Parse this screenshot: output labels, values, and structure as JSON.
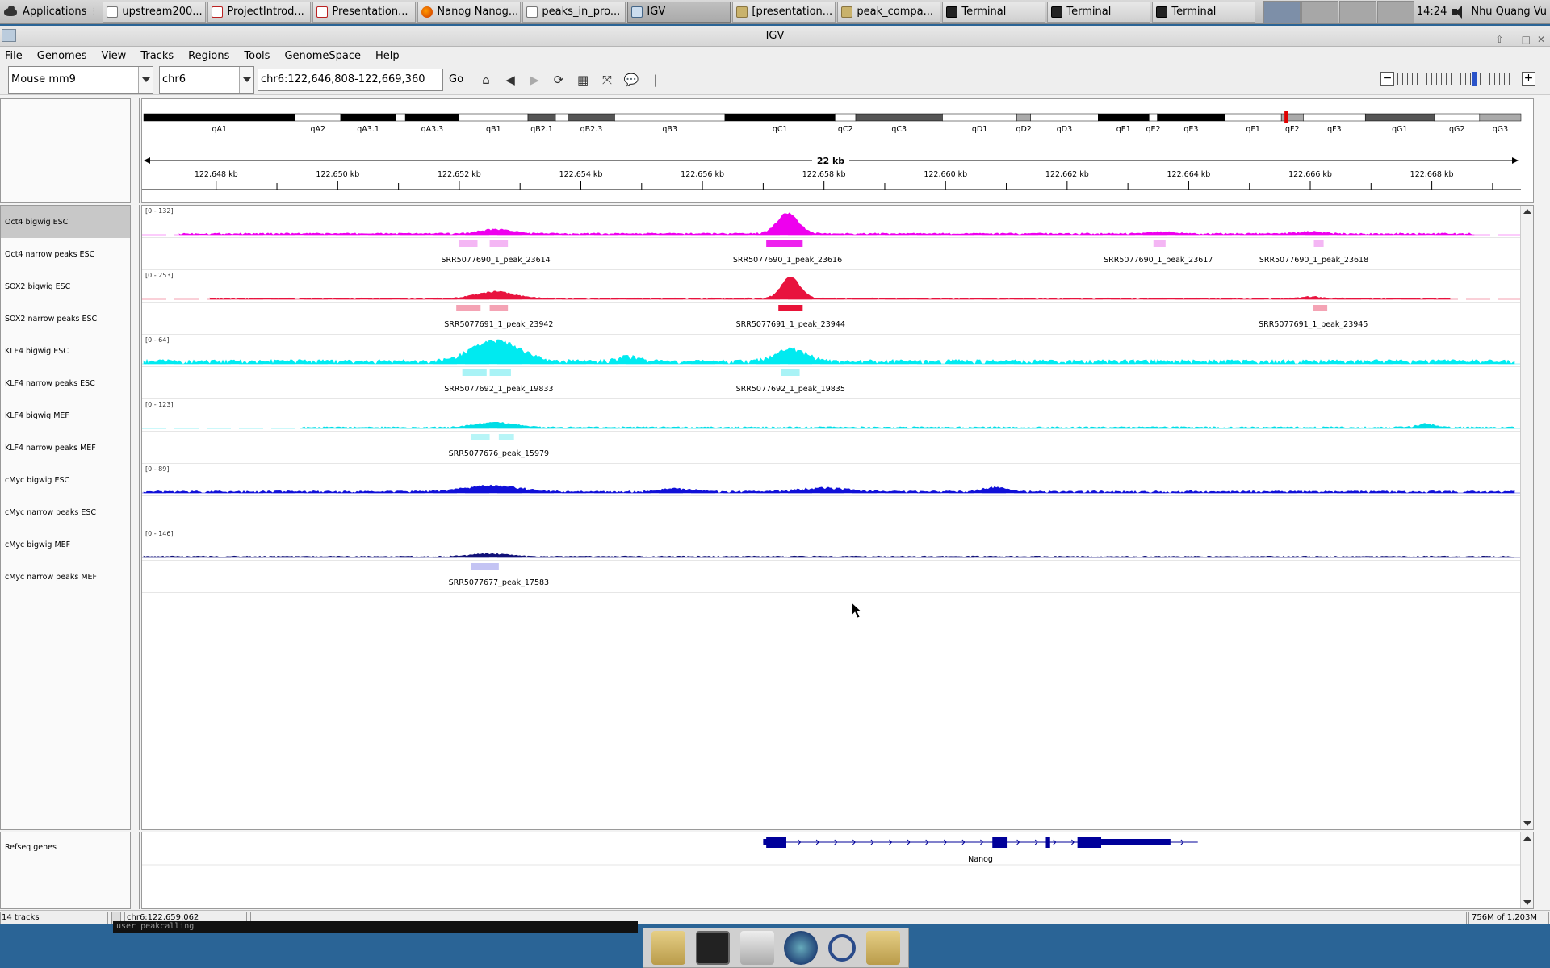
{
  "taskbar": {
    "apps_label": "Applications",
    "windows": [
      {
        "label": "upstream200...",
        "icon": "edit-icon",
        "cls": "edit"
      },
      {
        "label": "ProjectIntrod...",
        "icon": "pdf-icon",
        "cls": "pdf"
      },
      {
        "label": "Presentation...",
        "icon": "pdf-icon",
        "cls": "pdf"
      },
      {
        "label": "Nanog Nanog...",
        "icon": "firefox-icon",
        "cls": "ff"
      },
      {
        "label": "peaks_in_pro...",
        "icon": "edit-icon",
        "cls": "edit"
      },
      {
        "label": "IGV",
        "icon": "igv-icon",
        "cls": "igv",
        "active": true
      },
      {
        "label": "[presentation...",
        "icon": "folder-icon",
        "cls": "folder"
      },
      {
        "label": "peak_compa...",
        "icon": "folder-icon",
        "cls": "folder"
      },
      {
        "label": "Terminal",
        "icon": "terminal-icon",
        "cls": "term"
      },
      {
        "label": "Terminal",
        "icon": "terminal-icon",
        "cls": "term"
      },
      {
        "label": "Terminal",
        "icon": "terminal-icon",
        "cls": "term"
      }
    ],
    "clock": "14:24",
    "user": "Nhu Quang Vu"
  },
  "window": {
    "title": "IGV"
  },
  "menu": [
    "File",
    "Genomes",
    "View",
    "Tracks",
    "Regions",
    "Tools",
    "GenomeSpace",
    "Help"
  ],
  "toolbar": {
    "genome": "Mouse mm9",
    "chromosome": "chr6",
    "locus": "chr6:122,646,808-122,669,360",
    "go_label": "Go"
  },
  "ideogram": {
    "bands": [
      {
        "name": "qA1",
        "s": 0.0,
        "e": 0.11,
        "c": "#000"
      },
      {
        "name": "qA2",
        "s": 0.11,
        "e": 0.143,
        "c": "#fff"
      },
      {
        "name": "qA3.1",
        "s": 0.143,
        "e": 0.183,
        "c": "#000"
      },
      {
        "name": "",
        "s": 0.183,
        "e": 0.19,
        "c": "#fff"
      },
      {
        "name": "qA3.3",
        "s": 0.19,
        "e": 0.229,
        "c": "#000"
      },
      {
        "name": "qB1",
        "s": 0.229,
        "e": 0.279,
        "c": "#fff"
      },
      {
        "name": "qB2.1",
        "s": 0.279,
        "e": 0.299,
        "c": "#555"
      },
      {
        "name": "",
        "s": 0.299,
        "e": 0.308,
        "c": "#fff"
      },
      {
        "name": "qB2.3",
        "s": 0.308,
        "e": 0.342,
        "c": "#555"
      },
      {
        "name": "qB3",
        "s": 0.342,
        "e": 0.422,
        "c": "#fff"
      },
      {
        "name": "qC1",
        "s": 0.422,
        "e": 0.502,
        "c": "#000"
      },
      {
        "name": "qC2",
        "s": 0.502,
        "e": 0.517,
        "c": "#fff"
      },
      {
        "name": "qC3",
        "s": 0.517,
        "e": 0.58,
        "c": "#555"
      },
      {
        "name": "qD1",
        "s": 0.58,
        "e": 0.634,
        "c": "#fff"
      },
      {
        "name": "qD2",
        "s": 0.634,
        "e": 0.644,
        "c": "#aaa"
      },
      {
        "name": "qD3",
        "s": 0.644,
        "e": 0.693,
        "c": "#fff"
      },
      {
        "name": "qE1",
        "s": 0.693,
        "e": 0.73,
        "c": "#000"
      },
      {
        "name": "qE2",
        "s": 0.73,
        "e": 0.736,
        "c": "#fff"
      },
      {
        "name": "qE3",
        "s": 0.736,
        "e": 0.785,
        "c": "#000"
      },
      {
        "name": "qF1",
        "s": 0.785,
        "e": 0.826,
        "c": "#fff"
      },
      {
        "name": "qF2",
        "s": 0.826,
        "e": 0.842,
        "c": "#aaa"
      },
      {
        "name": "qF3",
        "s": 0.842,
        "e": 0.887,
        "c": "#fff"
      },
      {
        "name": "qG1",
        "s": 0.887,
        "e": 0.937,
        "c": "#555"
      },
      {
        "name": "qG2",
        "s": 0.937,
        "e": 0.97,
        "c": "#fff"
      },
      {
        "name": "qG3",
        "s": 0.97,
        "e": 1.0,
        "c": "#aaa"
      }
    ],
    "marker_pos": 0.8295,
    "marker_color": "#e00000"
  },
  "ruler": {
    "span_label": "22 kb",
    "start": 122646808,
    "end": 122669360,
    "ticks": [
      {
        "v": 122648000,
        "l": "122,648 kb"
      },
      {
        "v": 122650000,
        "l": "122,650 kb"
      },
      {
        "v": 122652000,
        "l": "122,652 kb"
      },
      {
        "v": 122654000,
        "l": "122,654 kb"
      },
      {
        "v": 122656000,
        "l": "122,656 kb"
      },
      {
        "v": 122658000,
        "l": "122,658 kb"
      },
      {
        "v": 122660000,
        "l": "122,660 kb"
      },
      {
        "v": 122662000,
        "l": "122,662 kb"
      },
      {
        "v": 122664000,
        "l": "122,664 kb"
      },
      {
        "v": 122666000,
        "l": "122,666 kb"
      },
      {
        "v": 122668000,
        "l": "122,668 kb"
      }
    ]
  },
  "tracks": [
    {
      "name": "Oct4 bigwig ESC",
      "type": "signal",
      "color": "#ee00ee",
      "range": "[0 - 132]",
      "selected": true,
      "peaks": [
        {
          "c": 122652600,
          "w": 600,
          "h": 0.18
        },
        {
          "c": 122657400,
          "w": 400,
          "h": 0.85
        },
        {
          "c": 122663500,
          "w": 500,
          "h": 0.08
        },
        {
          "c": 122666000,
          "w": 500,
          "h": 0.08
        }
      ],
      "base": 0.05,
      "extent": [
        122647400,
        122668700
      ]
    },
    {
      "name": "Oct4 narrow peaks ESC",
      "type": "peaks",
      "color": "#f4b6f4",
      "features": [
        {
          "s": 122652000,
          "e": 122652300,
          "l": "SRR5077690_1_peak_23614",
          "lc": 122652600
        },
        {
          "s": 122652500,
          "e": 122652800
        },
        {
          "s": 122657050,
          "e": 122657650,
          "l": "SRR5077690_1_peak_23616",
          "lc": 122657400,
          "strong": true
        },
        {
          "s": 122663420,
          "e": 122663620,
          "l": "SRR5077690_1_peak_23617",
          "lc": 122663500
        },
        {
          "s": 122666060,
          "e": 122666220,
          "l": "SRR5077690_1_peak_23618",
          "lc": 122666060
        }
      ]
    },
    {
      "name": "SOX2 bigwig ESC",
      "type": "signal",
      "color": "#e8133e",
      "range": "[0 - 253]",
      "peaks": [
        {
          "c": 122652600,
          "w": 700,
          "h": 0.28
        },
        {
          "c": 122657450,
          "w": 350,
          "h": 0.88
        },
        {
          "c": 122666000,
          "w": 400,
          "h": 0.08
        }
      ],
      "base": 0.04,
      "extent": [
        122647900,
        122668300
      ]
    },
    {
      "name": "SOX2 narrow peaks ESC",
      "type": "peaks",
      "color": "#f4a3b4",
      "features": [
        {
          "s": 122651950,
          "e": 122652350,
          "l": "SRR5077691_1_peak_23942",
          "lc": 122652650
        },
        {
          "s": 122652500,
          "e": 122652800
        },
        {
          "s": 122657250,
          "e": 122657650,
          "l": "SRR5077691_1_peak_23944",
          "lc": 122657450,
          "strong": true
        },
        {
          "s": 122666050,
          "e": 122666280,
          "l": "SRR5077691_1_peak_23945",
          "lc": 122666050
        }
      ]
    },
    {
      "name": "KLF4 bigwig ESC",
      "type": "signal",
      "color": "#00eaf0",
      "range": "[0 - 64]",
      "peaks": [
        {
          "c": 122652600,
          "w": 900,
          "h": 0.85
        },
        {
          "c": 122657450,
          "w": 600,
          "h": 0.5
        },
        {
          "c": 122654800,
          "w": 400,
          "h": 0.2
        }
      ],
      "base": 0.12,
      "extent": [
        122646808,
        122669360
      ]
    },
    {
      "name": "KLF4 narrow peaks ESC",
      "type": "peaks",
      "color": "#a9f3f6",
      "features": [
        {
          "s": 122652050,
          "e": 122652450,
          "l": "SRR5077692_1_peak_19833",
          "lc": 122652650
        },
        {
          "s": 122652500,
          "e": 122652850
        },
        {
          "s": 122657300,
          "e": 122657600,
          "l": "SRR5077692_1_peak_19835",
          "lc": 122657450
        }
      ]
    },
    {
      "name": "KLF4 bigwig MEF",
      "type": "signal",
      "color": "#00dde6",
      "range": "[0 - 123]",
      "peaks": [
        {
          "c": 122652600,
          "w": 700,
          "h": 0.2
        },
        {
          "c": 122667900,
          "w": 300,
          "h": 0.15
        }
      ],
      "base": 0.05,
      "extent": [
        122649400,
        122669360
      ]
    },
    {
      "name": "KLF4 narrow peaks MEF",
      "type": "peaks",
      "color": "#b7f5f7",
      "features": [
        {
          "s": 122652200,
          "e": 122652500,
          "l": "SRR5077676_peak_15979",
          "lc": 122652650
        },
        {
          "s": 122652650,
          "e": 122652900
        }
      ]
    },
    {
      "name": "cMyc bigwig ESC",
      "type": "signal",
      "color": "#1010d8",
      "range": "[0 - 89]",
      "peaks": [
        {
          "c": 122652550,
          "w": 1000,
          "h": 0.25
        },
        {
          "c": 122658000,
          "w": 900,
          "h": 0.15
        },
        {
          "c": 122655600,
          "w": 600,
          "h": 0.12
        },
        {
          "c": 122660800,
          "w": 400,
          "h": 0.18
        }
      ],
      "base": 0.06,
      "extent": [
        122646808,
        122669360
      ]
    },
    {
      "name": "cMyc narrow peaks ESC",
      "type": "peaks",
      "color": "#c4c4f4",
      "features": []
    },
    {
      "name": "cMyc bigwig MEF",
      "type": "signal",
      "color": "#101078",
      "range": "[0 - 146]",
      "peaks": [
        {
          "c": 122652500,
          "w": 700,
          "h": 0.12
        }
      ],
      "base": 0.04,
      "extent": [
        122646808,
        122669360
      ]
    },
    {
      "name": "cMyc narrow peaks MEF",
      "type": "peaks",
      "color": "#c4c4f4",
      "features": [
        {
          "s": 122652200,
          "e": 122652650,
          "l": "SRR5077677_peak_17583",
          "lc": 122652650
        }
      ]
    }
  ],
  "feature_track": {
    "name": "Refseq genes",
    "gene": "Nanog",
    "tx_start": 122657000,
    "tx_end": 122664150,
    "exons": [
      [
        122657050,
        122657380
      ],
      [
        122660770,
        122661020
      ],
      [
        122661650,
        122661720
      ],
      [
        122662170,
        122662560
      ],
      [
        122662560,
        122663700
      ]
    ],
    "color": "#00009a"
  },
  "status": {
    "tracks": "14 tracks",
    "position": "chr6:122,659,062",
    "memory": "756M of 1,203M"
  },
  "terminal_ghost": "user peakcalling"
}
